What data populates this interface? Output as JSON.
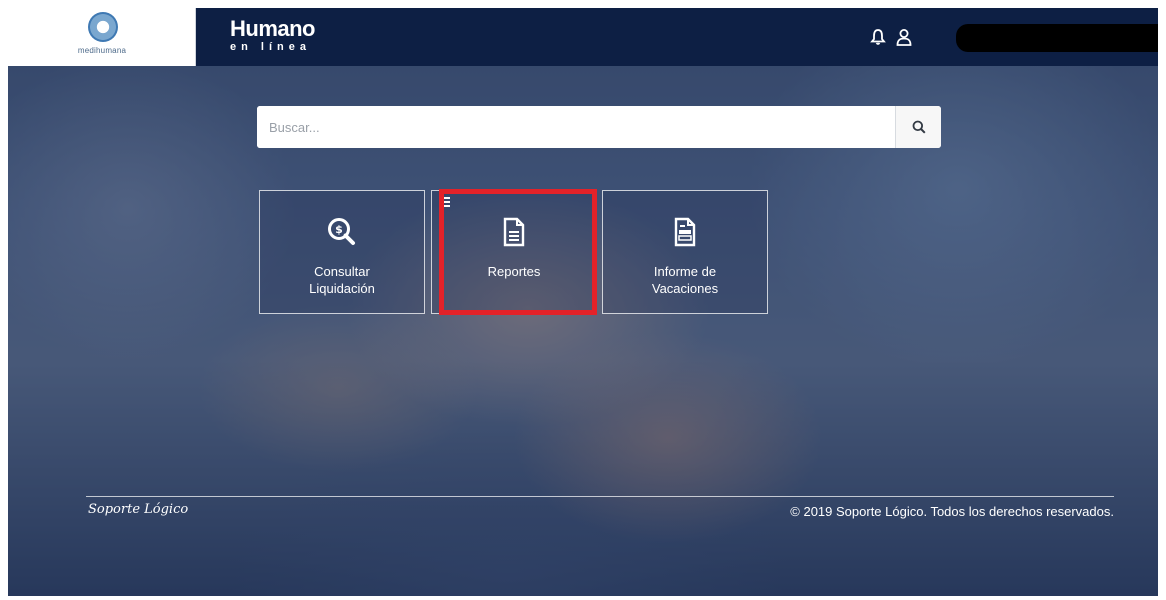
{
  "header": {
    "brand_name": "medihumana",
    "app_title": "Humano",
    "app_subtitle": "en línea",
    "notifications_icon": "bell-icon",
    "user_icon": "user-icon"
  },
  "search": {
    "placeholder": "Buscar...",
    "value": "",
    "button_icon": "search-icon"
  },
  "tiles": [
    {
      "label_line1": "Consultar",
      "label_line2": "Liquidación",
      "icon": "dollar-search-icon"
    },
    {
      "label_line1": "Reportes",
      "label_line2": "",
      "icon": "document-icon",
      "highlighted": true
    },
    {
      "label_line1": "Informe de",
      "label_line2": "Vacaciones",
      "icon": "vacation-report-icon"
    }
  ],
  "footer": {
    "signature": "Soporte Lógico",
    "copyright": "© 2019 Soporte Lógico. Todos los derechos reservados."
  },
  "colors": {
    "topbar": "#0d1f44",
    "highlight": "#e32229",
    "brand_accent": "#3f79b3"
  }
}
